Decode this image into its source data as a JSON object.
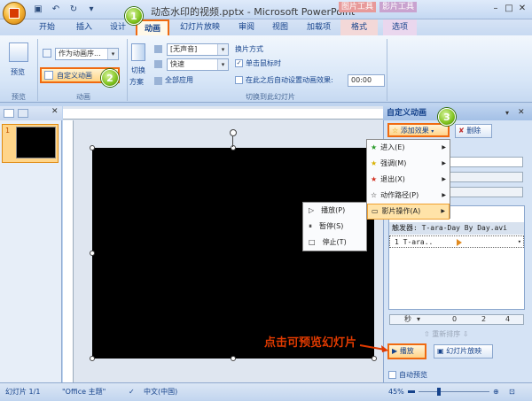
{
  "window": {
    "title": "动态水印的视频.pptx - Microsoft PowerPoint",
    "context_group_picture": "图片工具",
    "context_group_video": "影片工具"
  },
  "tabs": [
    "开始",
    "插入",
    "设计",
    "动画",
    "幻灯片放映",
    "审阅",
    "视图",
    "加载项",
    "格式",
    "选项"
  ],
  "ribbon": {
    "preview_label": "预览",
    "preview_group": "预览",
    "animate_dropdown": "作为动画序...",
    "custom_animation": "自定义动画",
    "animation_group": "动画",
    "switch_label_1": "切换",
    "switch_label_2": "方案",
    "sound_value": "[无声音]",
    "speed_value": "快速",
    "apply_all": "全部应用",
    "advance_title": "换片方式",
    "on_click": "单击鼠标时",
    "auto_after": "在此之后自动设置动画效果:",
    "time_value": "00:00",
    "transition_group": "切换到此幻灯片"
  },
  "slide_context_menu": [
    "播放(P)",
    "暂停(S)",
    "停止(T)"
  ],
  "task_pane": {
    "title": "自定义动画",
    "add_effect": "添加效果",
    "remove": "删除",
    "menu": [
      "进入(E)",
      "强调(M)",
      "退出(X)",
      "动作路径(P)",
      "影片操作(A)"
    ],
    "trigger": "触发器: T-ara-Day By Day.avi",
    "item": "1  T-ara..",
    "seconds": "秒",
    "scale_0": "0",
    "scale_2": "2",
    "scale_4": "4",
    "reorder": "重新排序",
    "play": "播放",
    "slideshow": "幻灯片放映",
    "autopreview": "自动预览"
  },
  "annotation": "点击可预览幻灯片",
  "markers": [
    "1",
    "2",
    "3"
  ],
  "status": {
    "slide": "幻灯片 1/1",
    "theme": "\"Office 主题\"",
    "lang": "中文(中国)",
    "zoom": "45%"
  },
  "thumbnail_number": "1"
}
